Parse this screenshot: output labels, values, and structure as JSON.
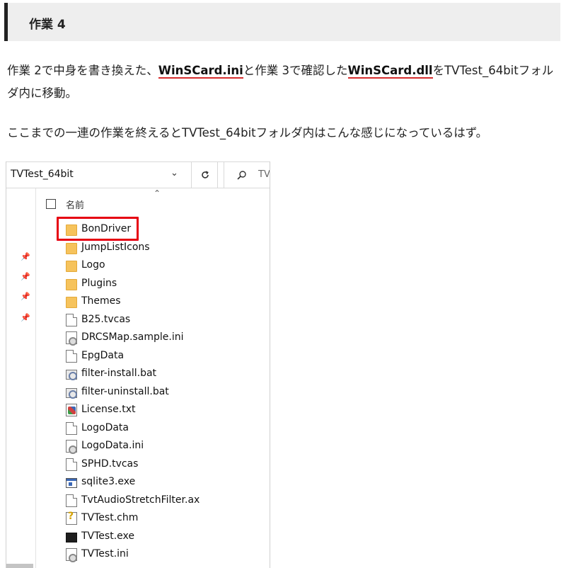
{
  "heading": {
    "title": "作業 4"
  },
  "para1": {
    "prefix": "作業 2で中身を書き換えた、",
    "file1": "WinSCard.ini",
    "middle": "と作業 3で確認した",
    "file2": "WinSCard.dll",
    "suffix": "をTVTest_64bitフォルダ内に移動。"
  },
  "para2": {
    "text": "ここまでの一連の作業を終えるとTVTest_64bitフォルダ内はこんな感じになっているはず。"
  },
  "explorer": {
    "address": "TVTest_64bit",
    "search_text": "TV",
    "column_name": "名前",
    "files": [
      {
        "name": "BonDriver",
        "type": "folder",
        "icon": "folder-icon"
      },
      {
        "name": "JumpListIcons",
        "type": "folder",
        "icon": "folder-icon"
      },
      {
        "name": "Logo",
        "type": "folder",
        "icon": "folder-icon"
      },
      {
        "name": "Plugins",
        "type": "folder",
        "icon": "folder-icon"
      },
      {
        "name": "Themes",
        "type": "folder",
        "icon": "folder-icon"
      },
      {
        "name": "B25.tvcas",
        "type": "file",
        "icon": "file-icon"
      },
      {
        "name": "DRCSMap.sample.ini",
        "type": "gear",
        "icon": "settings-file-icon"
      },
      {
        "name": "EpgData",
        "type": "file",
        "icon": "file-icon"
      },
      {
        "name": "filter-install.bat",
        "type": "bat",
        "icon": "batch-file-icon"
      },
      {
        "name": "filter-uninstall.bat",
        "type": "bat",
        "icon": "batch-file-icon"
      },
      {
        "name": "License.txt",
        "type": "lic",
        "icon": "license-file-icon"
      },
      {
        "name": "LogoData",
        "type": "file",
        "icon": "file-icon"
      },
      {
        "name": "LogoData.ini",
        "type": "gear",
        "icon": "settings-file-icon"
      },
      {
        "name": "SPHD.tvcas",
        "type": "file",
        "icon": "file-icon"
      },
      {
        "name": "sqlite3.exe",
        "type": "exe",
        "icon": "executable-icon"
      },
      {
        "name": "TvtAudioStretchFilter.ax",
        "type": "file",
        "icon": "file-icon"
      },
      {
        "name": "TVTest.chm",
        "type": "chm",
        "icon": "help-file-icon"
      },
      {
        "name": "TVTest.exe",
        "type": "tvexe",
        "icon": "tvtest-executable-icon"
      },
      {
        "name": "TVTest.ini",
        "type": "gear",
        "icon": "settings-file-icon"
      }
    ]
  },
  "colors": {
    "underline": "#d62d2d",
    "highlight": "#e60012",
    "folder": "#f6c35c"
  }
}
